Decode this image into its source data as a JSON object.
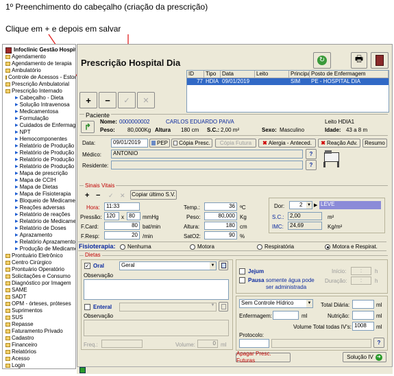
{
  "caption": {
    "line1": "1º Preenchimento do cabeçalho (criação da prescrição)",
    "line2": "Clique em + e depois em salvar"
  },
  "app_title": "Infoclinic Gestão Hospitalar - PMP",
  "form_title": "Prescrição Hospital Dia",
  "sidebar": [
    {
      "label": "Agendamento",
      "level": 0
    },
    {
      "label": "Agendamento de terapia",
      "level": 0
    },
    {
      "label": "Ambulatório",
      "level": 0
    },
    {
      "label": "Controle de Acessos - Estoque",
      "level": 0
    },
    {
      "label": "Prescrição Ambulatorial",
      "level": 0
    },
    {
      "label": "Prescrição Internado",
      "level": 0
    },
    {
      "label": "Cabeçalho - Dieta",
      "level": 1
    },
    {
      "label": "Solução Intravenosa",
      "level": 1
    },
    {
      "label": "Medicamentosa",
      "level": 1
    },
    {
      "label": "Formulação",
      "level": 1
    },
    {
      "label": "Cuidados de Enfermagem",
      "level": 1
    },
    {
      "label": "NPT",
      "level": 1
    },
    {
      "label": "Hemocomponentes",
      "level": 1
    },
    {
      "label": "Relatório de Produção",
      "level": 1
    },
    {
      "label": "Relatório de Produção",
      "level": 1
    },
    {
      "label": "Relatório de Produção",
      "level": 1
    },
    {
      "label": "Relatório de Produção",
      "level": 1
    },
    {
      "label": "Mapa de prescrição",
      "level": 1
    },
    {
      "label": "Mapa de CCIH",
      "level": 1
    },
    {
      "label": "Mapa de Dietas",
      "level": 1
    },
    {
      "label": "Mapa de Fisioterapia",
      "level": 1
    },
    {
      "label": "Bloqueio de Medicamento",
      "level": 1
    },
    {
      "label": "Reações adversas",
      "level": 1
    },
    {
      "label": "Relatório de reações",
      "level": 1
    },
    {
      "label": "Relatório de Medicamento",
      "level": 1
    },
    {
      "label": "Relatório de Doses",
      "level": 1
    },
    {
      "label": "Aprazamento",
      "level": 1
    },
    {
      "label": "Relatório Aprazamento",
      "level": 1
    },
    {
      "label": "Produção de Medicamentos",
      "level": 1
    },
    {
      "label": "Prontuário Eletrônico",
      "level": 0
    },
    {
      "label": "Centro Cirúrgico",
      "level": 0
    },
    {
      "label": "Prontuário Operatório",
      "level": 0
    },
    {
      "label": "Solicitações e Consumo",
      "level": 0
    },
    {
      "label": "Diagnóstico por Imagem",
      "level": 0
    },
    {
      "label": "SAME",
      "level": 0
    },
    {
      "label": "SADT",
      "level": 0
    },
    {
      "label": "OPM - órteses, próteses",
      "level": 0
    },
    {
      "label": "Suprimentos",
      "level": 0
    },
    {
      "label": "SUS",
      "level": 0
    },
    {
      "label": "Repasse",
      "level": 0
    },
    {
      "label": "Faturamento Privado",
      "level": 0
    },
    {
      "label": "Cadastro",
      "level": 0
    },
    {
      "label": "Financeiro",
      "level": 0
    },
    {
      "label": "Relatórios",
      "level": 0
    },
    {
      "label": "Acesso",
      "level": 0
    },
    {
      "label": "Login",
      "level": 0
    }
  ],
  "grid": {
    "columns": [
      "ID",
      "Tipo",
      "Data",
      "Leito",
      "Principal",
      "Posto de Enfermagem"
    ],
    "rows": [
      [
        "77",
        "HDIA",
        "09/01/2019",
        "",
        "SIM",
        "PE - HOSPITAL DIA"
      ]
    ]
  },
  "toolbar": {
    "add": "+",
    "remove": "−",
    "save": "✓",
    "cancel": "✕"
  },
  "patient": {
    "section": "Paciente",
    "nome_label": "Nome:",
    "nome_code": "0000000002",
    "nome": "CARLOS EDUARDO PAIVA",
    "leito": "Leito HDIA1",
    "peso_label": "Peso:",
    "peso": "80,000Kg",
    "altura_label": "Altura",
    "altura": "180 cm",
    "sc_label": "S.C.:",
    "sc": "2,00 m²",
    "sexo_label": "Sexo:",
    "sexo": "Masculino",
    "idade_label": "Idade:",
    "idade": "43 a 8 m"
  },
  "header": {
    "data_label": "Data:",
    "data_value": "09/01/2019",
    "pep": "PEP",
    "copia_presc": "Cópia Presc.",
    "copia_futura": "Cópia Futura",
    "alergia": "Alergia - Anteced.",
    "reacao": "Reação Adv.",
    "resumo": "Resumo",
    "medico_label": "Médico:",
    "medico_value": "ANTONIO",
    "residente_label": "Residente:",
    "help": "?"
  },
  "vitals": {
    "section": "Sinais Vitais",
    "copy_last": "Copiar último S.V.",
    "hora_label": "Hora:",
    "hora": "11:33",
    "pressao_label": "Pressão:",
    "pressao_sis": "120",
    "x": "x",
    "pressao_dia": "80",
    "mmhg": "mmHg",
    "fcard_label": "F.Card:",
    "fcard": "80",
    "bpm": "bat/min",
    "fresp_label": "F.Resp:",
    "fresp": "20",
    "rpm": "/min",
    "temp_label": "Temp.:",
    "temp": "36",
    "temp_unit": "ºC",
    "peso_label": "Peso:",
    "peso": "80,000",
    "peso_unit": "Kg",
    "altura_label": "Altura:",
    "altura": "180",
    "altura_unit": "cm",
    "sat_label": "SatO2:",
    "sat": "90",
    "sat_unit": "%",
    "dor_label": "Dor:",
    "dor": "2",
    "dor_level": "LEVE",
    "sc_label": "S.C.:",
    "sc": "2,00",
    "sc_unit": "m²",
    "imc_label": "IMC:",
    "imc": "24,69",
    "imc_unit": "Kg/m²"
  },
  "fisio": {
    "label": "Fisioterapia:",
    "options": [
      "Nenhuma",
      "Motora",
      "Respiratória",
      "Motora e Respirat."
    ],
    "selected": "Motora e Respirat."
  },
  "dietas": {
    "section": "Dietas",
    "oral": "Oral",
    "oral_value": "Geral",
    "observacao": "Observação",
    "enteral": "Enteral",
    "observacao2": "Observação",
    "freq": "Freq.:",
    "volume": "Volume:",
    "volume_value": "0",
    "ml": "ml",
    "jejum": "Jejum",
    "pausa": "Pausa",
    "pausa_note": "somente água pode ser administrada",
    "inicio": "Início:",
    "duracao": "Duração:",
    "h": "h",
    "colon": ":"
  },
  "hidrico": {
    "controle": "Sem Controle Hídrico",
    "total_diaria": "Total Diária:",
    "enfermagem": "Enfermagem:",
    "nutricao": "Nutrição:",
    "vol_total": "Volume Total todas IV's:",
    "vol_value": "1008",
    "protocolo": "Protocolo:",
    "ml": "ml"
  },
  "bottom": {
    "apagar": "Apagar Presc. Futuras",
    "solucao": "Solução IV"
  },
  "colors": {
    "accent": "#3169c6",
    "arrow": "#e02020",
    "title_red": "#c00000"
  }
}
